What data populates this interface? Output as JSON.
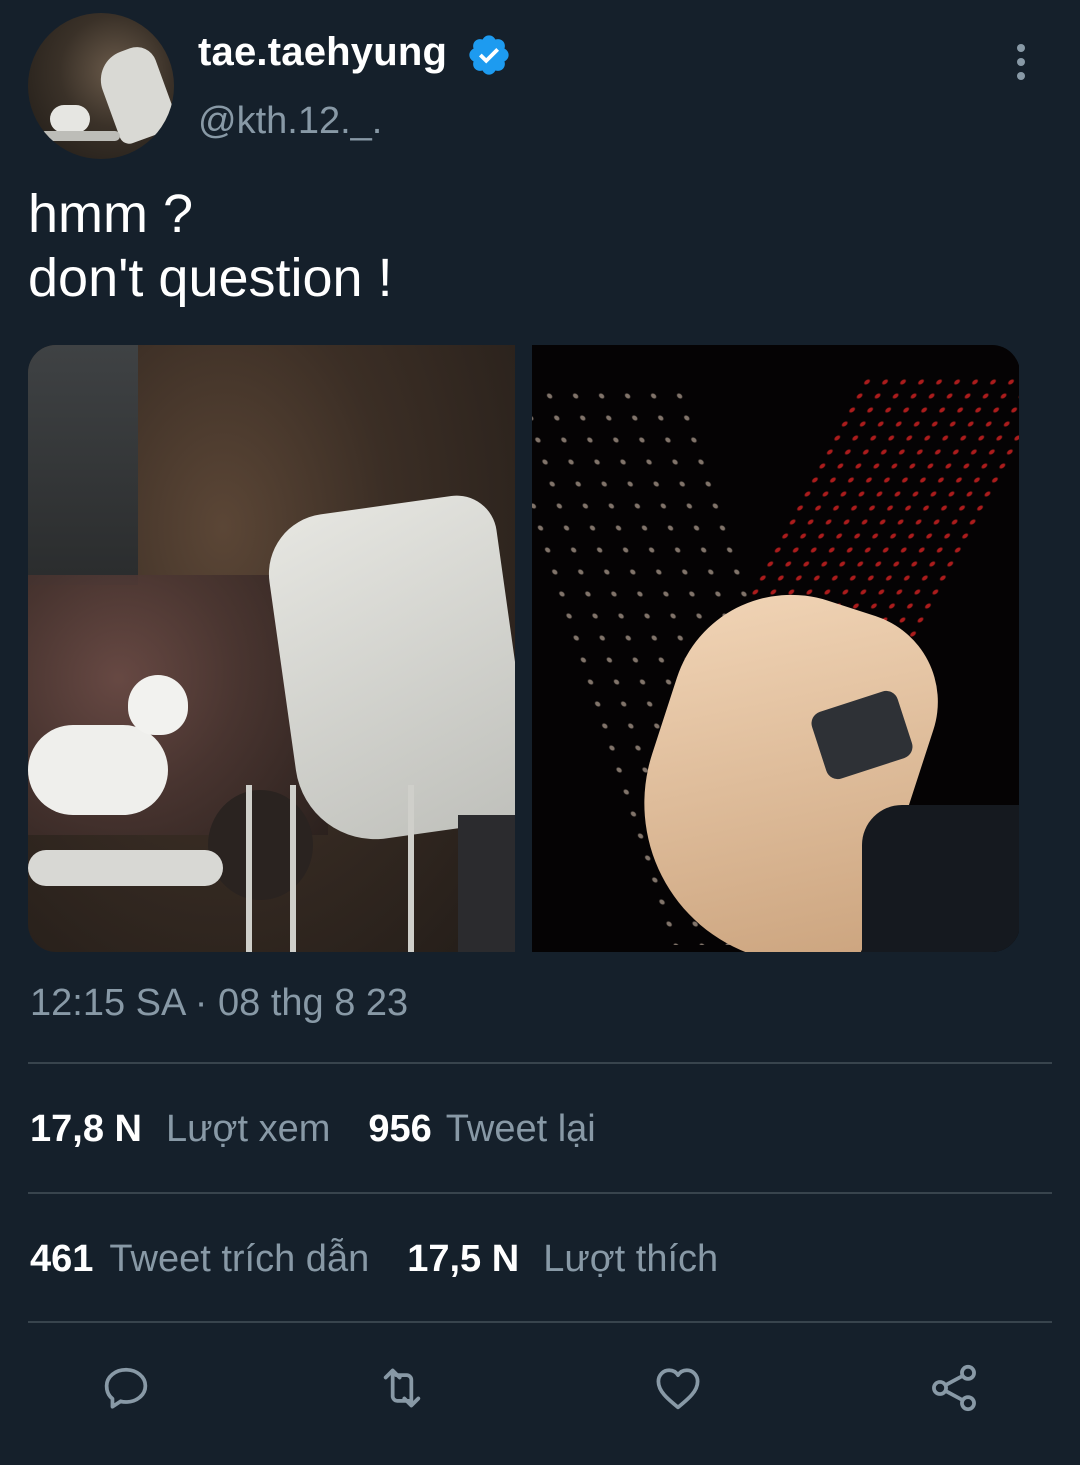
{
  "tweet": {
    "author": {
      "display_name": "tae.taehyung",
      "handle": "@kth.12._.",
      "verified": true
    },
    "text": "hmm ?\ndon't question !",
    "timestamp": "12:15 SA · 08 thg 8 23",
    "stats": {
      "views": {
        "value": "17,8 N",
        "label": "Lượt xem"
      },
      "retweets": {
        "value": "956",
        "label": "Tweet lại"
      },
      "quotes": {
        "value": "461",
        "label": "Tweet trích dẫn"
      },
      "likes": {
        "value": "17,5 N",
        "label": "Lượt thích"
      }
    }
  },
  "icons": {
    "verified": "verified-badge-icon",
    "more": "more-vertical-icon",
    "reply": "reply-icon",
    "retweet": "retweet-icon",
    "like": "heart-icon",
    "share": "share-icon"
  },
  "colors": {
    "background": "#15202b",
    "secondary_text": "#8899a6",
    "divider": "#38444d",
    "verified_blue": "#1d9bf0"
  }
}
